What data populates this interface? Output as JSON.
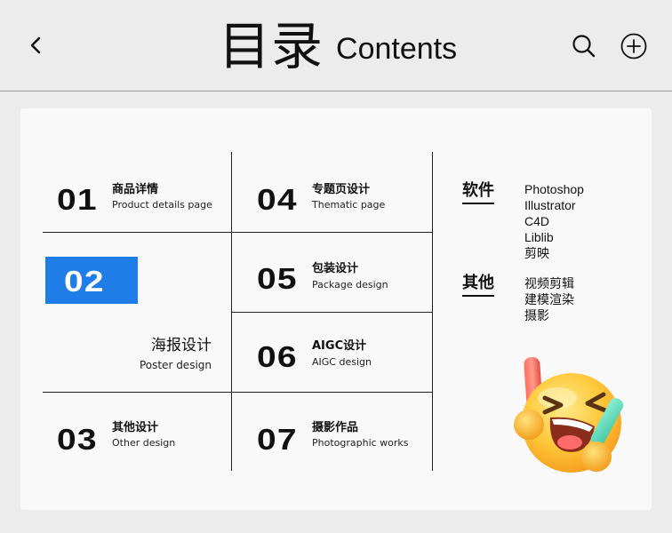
{
  "header": {
    "title_cn": "目录",
    "title_en": "Contents"
  },
  "toc": {
    "items": [
      {
        "num": "01",
        "cn": "商品详情",
        "en": "Product details page"
      },
      {
        "num": "02",
        "cn": "海报设计",
        "en": "Poster design"
      },
      {
        "num": "03",
        "cn": "其他设计",
        "en": "Other design"
      },
      {
        "num": "04",
        "cn": "专题页设计",
        "en": "Thematic page"
      },
      {
        "num": "05",
        "cn": "包装设计",
        "en": "Package design"
      },
      {
        "num": "06",
        "cn": "AIGC设计",
        "en": "AIGC design"
      },
      {
        "num": "07",
        "cn": "摄影作品",
        "en": "Photographic works"
      }
    ]
  },
  "sidebar": {
    "software": {
      "heading": "软件",
      "items": [
        "Photoshop",
        "Illustrator",
        "C4D",
        "Liblib",
        "剪映"
      ]
    },
    "other": {
      "heading": "其他",
      "items": [
        "视频剪辑",
        "建模渲染",
        "摄影"
      ]
    }
  },
  "colors": {
    "accent": "#1f7de8",
    "background": "#ececec",
    "card": "#f9f9f9",
    "text": "#111111"
  },
  "icons": {
    "back": "chevron-left-icon",
    "search": "search-icon",
    "add": "plus-circle-icon",
    "emoji": "laughing-emoji-icon"
  }
}
